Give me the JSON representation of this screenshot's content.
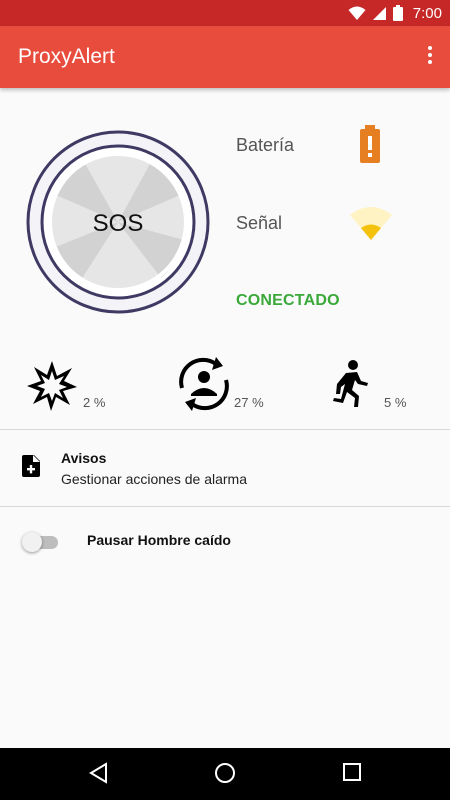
{
  "status_bar": {
    "time": "7:00"
  },
  "app_bar": {
    "title": "ProxyAlert"
  },
  "sos": {
    "label": "SOS"
  },
  "info": {
    "battery_label": "Batería",
    "signal_label": "Señal",
    "connection_status": "CONECTADO",
    "battery_color": "#e67e22",
    "signal_color": "#f4c20d",
    "connected_color": "#3aa93a"
  },
  "stats": [
    {
      "icon": "impact-icon",
      "value": "2 %"
    },
    {
      "icon": "rotation-person-icon",
      "value": "27 %"
    },
    {
      "icon": "running-person-icon",
      "value": "5 %"
    }
  ],
  "avisos": {
    "title": "Avisos",
    "subtitle": "Gestionar acciones de alarma"
  },
  "pause_toggle": {
    "label": "Pausar Hombre caído",
    "enabled": false
  },
  "colors": {
    "app_bar": "#e84c3d",
    "status_bar": "#c62828"
  }
}
